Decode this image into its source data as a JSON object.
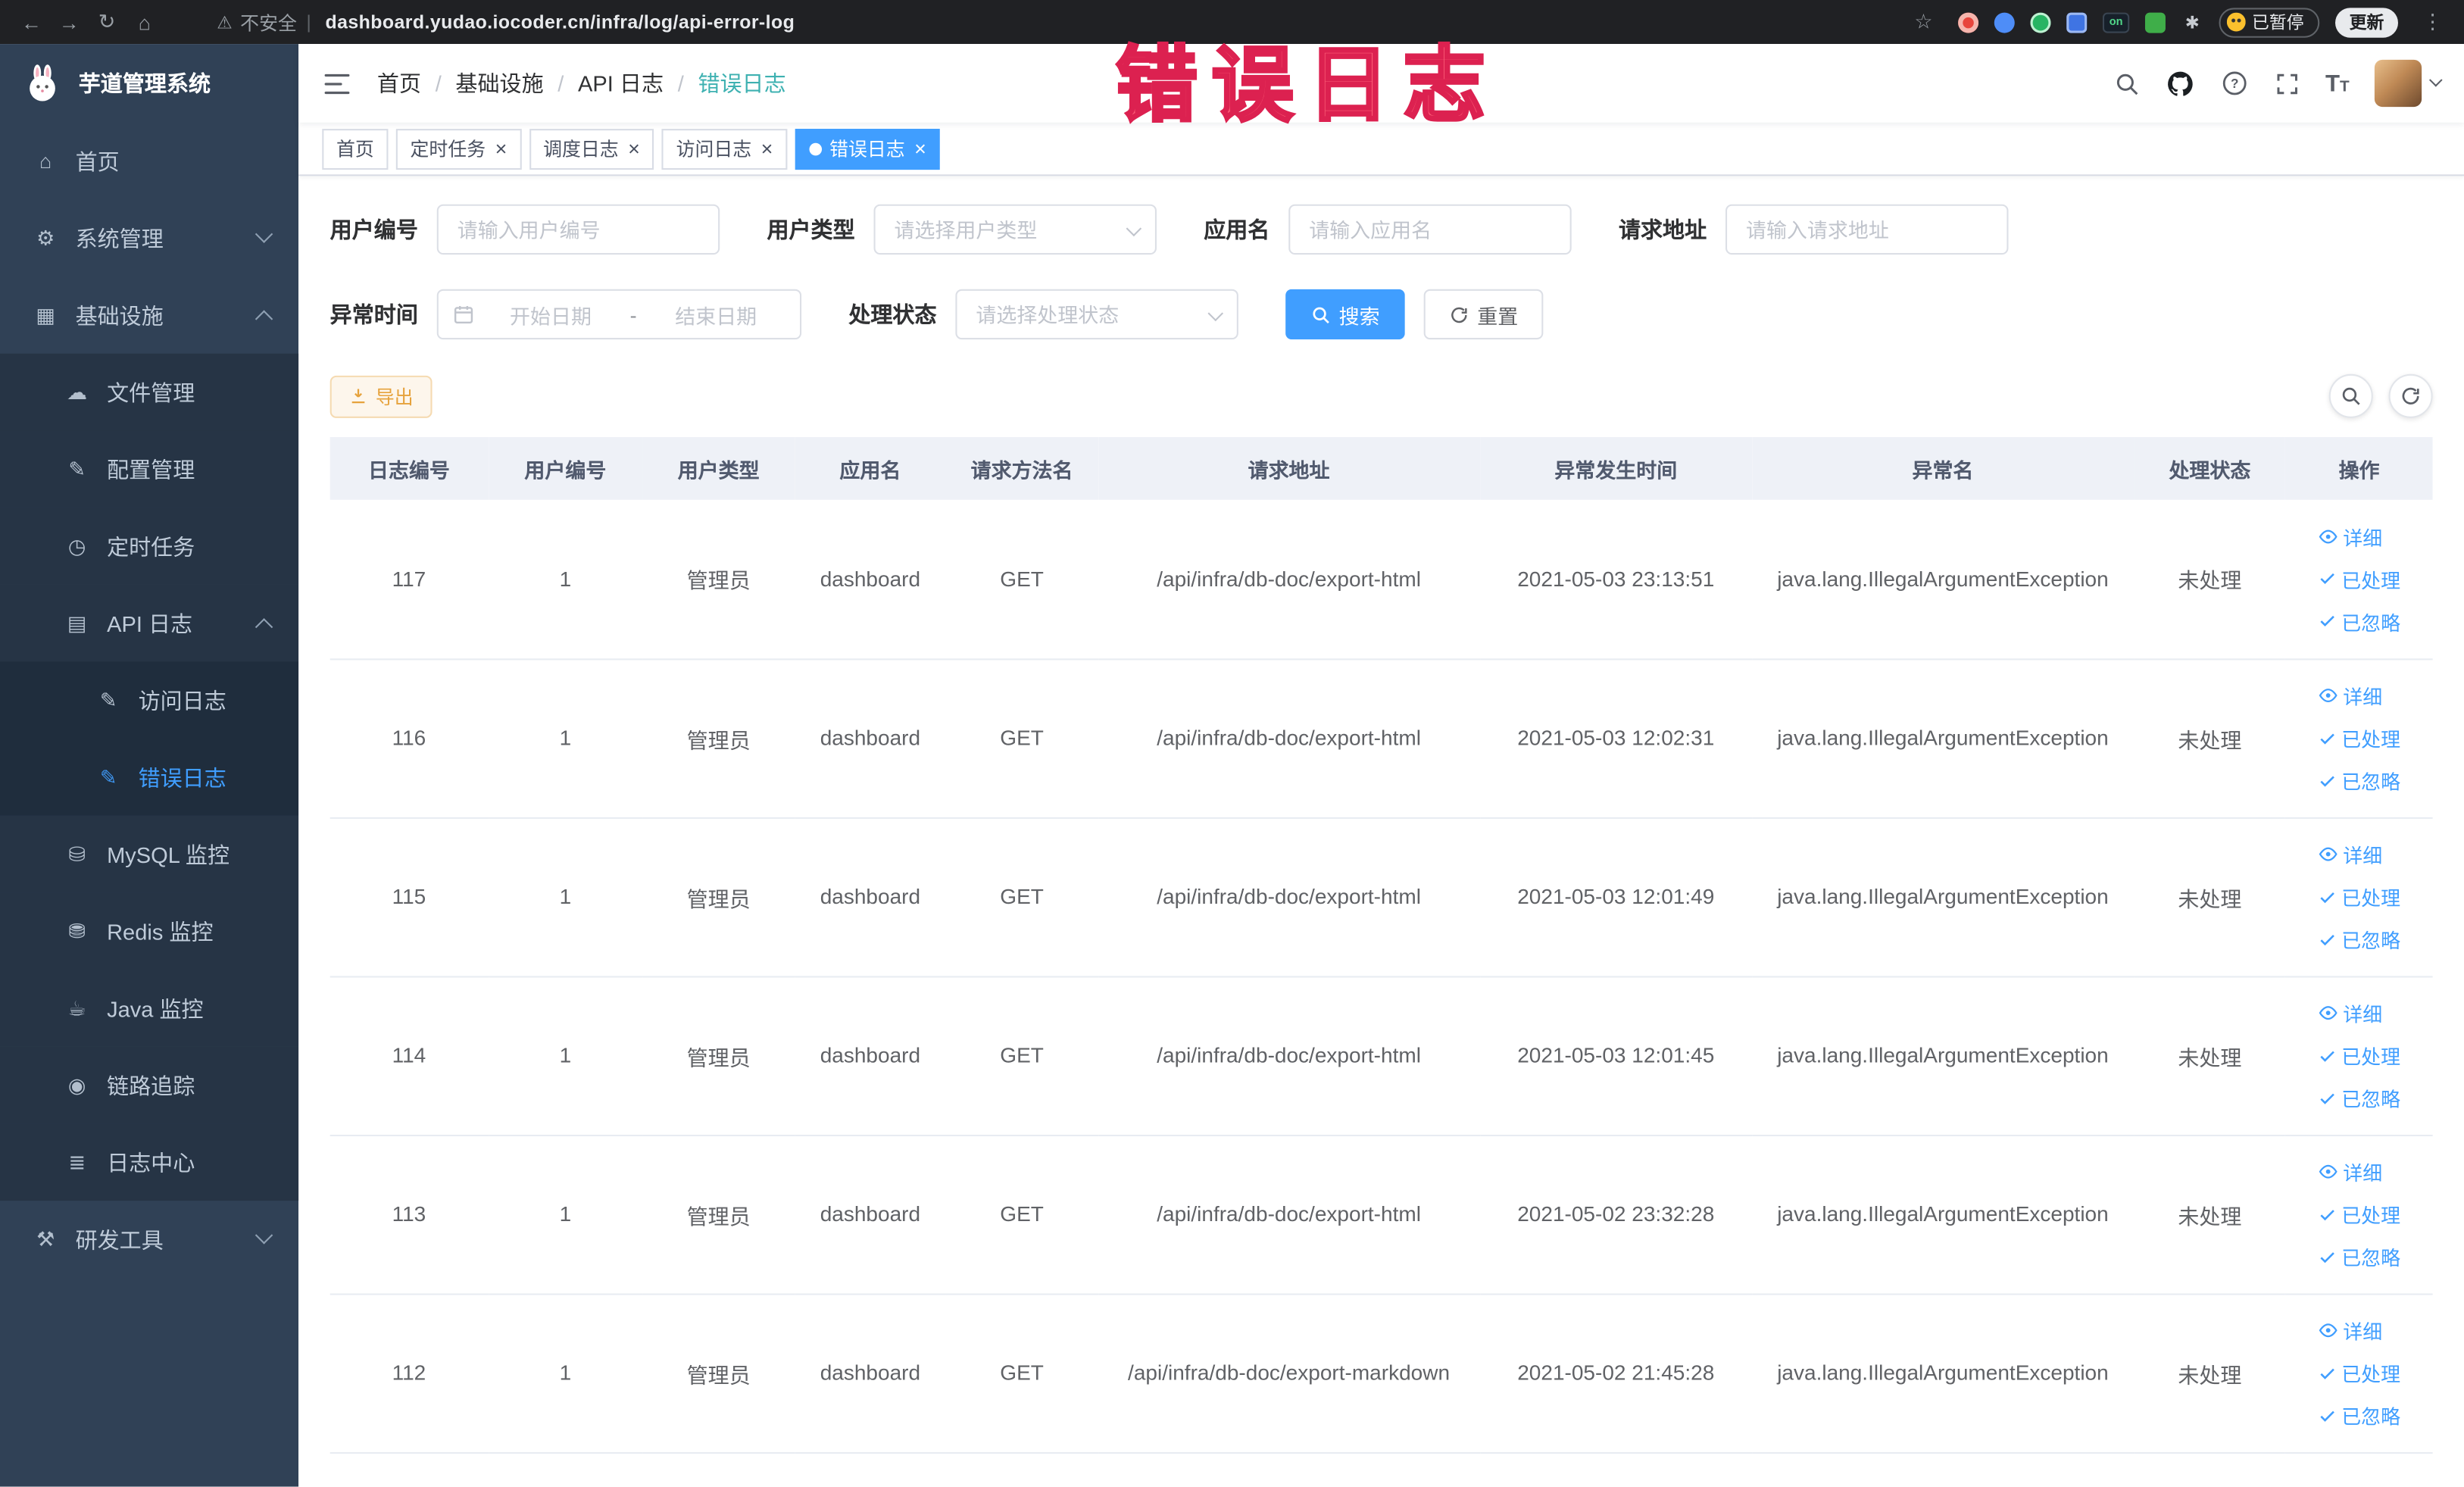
{
  "browser": {
    "security_label": "不安全",
    "url": "dashboard.yudao.iocoder.cn/infra/log/api-error-log",
    "extension_on_label": "on",
    "paused_label": "已暂停",
    "update_label": "更新"
  },
  "watermark": "错误日志",
  "sidebar": {
    "logo_title": "芋道管理系统",
    "items": [
      {
        "key": "home",
        "label": "首页",
        "icon": "home-icon",
        "level": 1
      },
      {
        "key": "system",
        "label": "系统管理",
        "icon": "gear-icon",
        "level": 1,
        "arrow": "down"
      },
      {
        "key": "infra",
        "label": "基础设施",
        "icon": "infra-icon",
        "level": 1,
        "arrow": "up"
      },
      {
        "key": "file",
        "label": "文件管理",
        "icon": "file-icon",
        "level": 2
      },
      {
        "key": "config",
        "label": "配置管理",
        "icon": "config-icon",
        "level": 2
      },
      {
        "key": "job",
        "label": "定时任务",
        "icon": "timer-icon",
        "level": 2
      },
      {
        "key": "api-log",
        "label": "API 日志",
        "icon": "api-log-icon",
        "level": 2,
        "arrow": "up"
      },
      {
        "key": "access-log",
        "label": "访问日志",
        "icon": "doc-icon",
        "level": 3
      },
      {
        "key": "error-log",
        "label": "错误日志",
        "icon": "doc-icon",
        "level": 3,
        "active": true
      },
      {
        "key": "mysql",
        "label": "MySQL 监控",
        "icon": "database-icon",
        "level": 2
      },
      {
        "key": "redis",
        "label": "Redis 监控",
        "icon": "redis-icon",
        "level": 2
      },
      {
        "key": "java",
        "label": "Java 监控",
        "icon": "java-icon",
        "level": 2
      },
      {
        "key": "trace",
        "label": "链路追踪",
        "icon": "trace-icon",
        "level": 2
      },
      {
        "key": "log-center",
        "label": "日志中心",
        "icon": "log-center-icon",
        "level": 2
      },
      {
        "key": "dev-tools",
        "label": "研发工具",
        "icon": "tools-icon",
        "level": 1,
        "arrow": "down"
      }
    ]
  },
  "breadcrumb": [
    "首页",
    "基础设施",
    "API 日志",
    "错误日志"
  ],
  "tabs": [
    {
      "key": "home",
      "label": "首页",
      "closable": false,
      "active": false
    },
    {
      "key": "cron-job",
      "label": "定时任务",
      "closable": true,
      "active": false
    },
    {
      "key": "job-log",
      "label": "调度日志",
      "closable": true,
      "active": false
    },
    {
      "key": "access-log",
      "label": "访问日志",
      "closable": true,
      "active": false
    },
    {
      "key": "error-log",
      "label": "错误日志",
      "closable": true,
      "active": true
    }
  ],
  "filters": {
    "user_id": {
      "label": "用户编号",
      "placeholder": "请输入用户编号"
    },
    "user_type": {
      "label": "用户类型",
      "placeholder": "请选择用户类型"
    },
    "app_name": {
      "label": "应用名",
      "placeholder": "请输入应用名"
    },
    "request_url": {
      "label": "请求地址",
      "placeholder": "请输入请求地址"
    },
    "exception_time": {
      "label": "异常时间",
      "start_placeholder": "开始日期",
      "separator": "-",
      "end_placeholder": "结束日期"
    },
    "process_status": {
      "label": "处理状态",
      "placeholder": "请选择处理状态"
    },
    "search_label": "搜索",
    "reset_label": "重置"
  },
  "toolbar": {
    "export_label": "导出"
  },
  "table": {
    "columns": [
      "日志编号",
      "用户编号",
      "用户类型",
      "应用名",
      "请求方法名",
      "请求地址",
      "异常发生时间",
      "异常名",
      "处理状态",
      "操作"
    ],
    "actions": [
      "详细",
      "已处理",
      "已忽略"
    ],
    "rows": [
      {
        "id": "117",
        "user_id": "1",
        "user_type": "管理员",
        "app": "dashboard",
        "method": "GET",
        "url": "/api/infra/db-doc/export-html",
        "time": "2021-05-03 23:13:51",
        "exception": "java.lang.IllegalArgumentException",
        "status": "未处理"
      },
      {
        "id": "116",
        "user_id": "1",
        "user_type": "管理员",
        "app": "dashboard",
        "method": "GET",
        "url": "/api/infra/db-doc/export-html",
        "time": "2021-05-03 12:02:31",
        "exception": "java.lang.IllegalArgumentException",
        "status": "未处理"
      },
      {
        "id": "115",
        "user_id": "1",
        "user_type": "管理员",
        "app": "dashboard",
        "method": "GET",
        "url": "/api/infra/db-doc/export-html",
        "time": "2021-05-03 12:01:49",
        "exception": "java.lang.IllegalArgumentException",
        "status": "未处理"
      },
      {
        "id": "114",
        "user_id": "1",
        "user_type": "管理员",
        "app": "dashboard",
        "method": "GET",
        "url": "/api/infra/db-doc/export-html",
        "time": "2021-05-03 12:01:45",
        "exception": "java.lang.IllegalArgumentException",
        "status": "未处理"
      },
      {
        "id": "113",
        "user_id": "1",
        "user_type": "管理员",
        "app": "dashboard",
        "method": "GET",
        "url": "/api/infra/db-doc/export-html",
        "time": "2021-05-02 23:32:28",
        "exception": "java.lang.IllegalArgumentException",
        "status": "未处理"
      },
      {
        "id": "112",
        "user_id": "1",
        "user_type": "管理员",
        "app": "dashboard",
        "method": "GET",
        "url": "/api/infra/db-doc/export-markdown",
        "time": "2021-05-02 21:45:28",
        "exception": "java.lang.IllegalArgumentException",
        "status": "未处理"
      }
    ]
  },
  "colors": {
    "accent": "#409eff",
    "warning": "#e6a23c",
    "sidebar_bg": "#304156",
    "watermark_red": "#dc2150"
  }
}
